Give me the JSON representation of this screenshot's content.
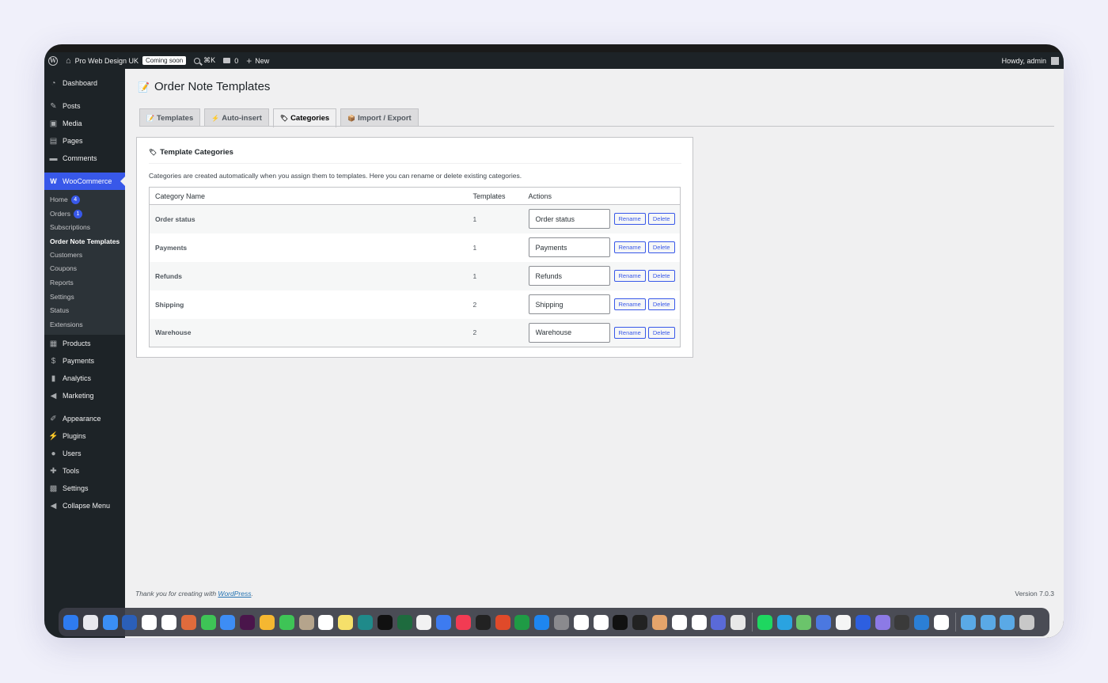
{
  "adminbar": {
    "site_name": "Pro Web Design UK",
    "coming_soon": "Coming soon",
    "shortcut": "⌘K",
    "comments_count": "0",
    "new_label": "New",
    "howdy": "Howdy, admin"
  },
  "sidebar": {
    "dashboard": "Dashboard",
    "posts": "Posts",
    "media": "Media",
    "pages": "Pages",
    "comments": "Comments",
    "woocommerce": "WooCommerce",
    "sub": {
      "home": "Home",
      "home_count": "4",
      "orders": "Orders",
      "orders_count": "1",
      "subscriptions": "Subscriptions",
      "order_note_templates": "Order Note Templates",
      "customers": "Customers",
      "coupons": "Coupons",
      "reports": "Reports",
      "settings": "Settings",
      "status": "Status",
      "extensions": "Extensions"
    },
    "products": "Products",
    "payments": "Payments",
    "analytics": "Analytics",
    "marketing": "Marketing",
    "appearance": "Appearance",
    "plugins": "Plugins",
    "users": "Users",
    "tools": "Tools",
    "settings": "Settings",
    "collapse": "Collapse Menu"
  },
  "page": {
    "title": "Order Note Templates",
    "tabs": {
      "templates": "Templates",
      "auto_insert": "Auto-insert",
      "categories": "Categories",
      "import_export": "Import / Export"
    },
    "card_title": "Template Categories",
    "description": "Categories are created automatically when you assign them to templates. Here you can rename or delete existing categories.",
    "table": {
      "headers": {
        "name": "Category Name",
        "templates": "Templates",
        "actions": "Actions"
      },
      "rename_label": "Rename",
      "delete_label": "Delete",
      "rows": [
        {
          "name": "Order status",
          "count": "1"
        },
        {
          "name": "Payments",
          "count": "1"
        },
        {
          "name": "Refunds",
          "count": "1"
        },
        {
          "name": "Shipping",
          "count": "2"
        },
        {
          "name": "Warehouse",
          "count": "2"
        }
      ]
    }
  },
  "footer": {
    "thanks_prefix": "Thank you for creating with ",
    "wordpress": "WordPress",
    "thanks_suffix": ".",
    "version": "Version 7.0.3"
  },
  "dock": {
    "icon_names": [
      "finder-icon",
      "launchpad-icon",
      "safari-icon",
      "maps-icon",
      "calendar-icon",
      "chatgpt-icon",
      "claude-icon",
      "messages-icon",
      "mail-icon",
      "slack-icon",
      "photos-icon",
      "facetime-icon",
      "contacts-icon",
      "reminders-icon",
      "notes-icon",
      "freeform-icon",
      "tv-icon",
      "app-icon",
      "app-icon",
      "app-icon",
      "music-icon",
      "terminal-icon",
      "app-icon",
      "numbers-icon",
      "app-store-icon",
      "settings-icon",
      "app-icon",
      "app-icon",
      "app-icon",
      "app-icon",
      "app-icon",
      "app-icon",
      "app-icon",
      "app-icon",
      "app-icon",
      "spotify-icon",
      "telegram-icon",
      "app-icon",
      "app-icon",
      "app-icon",
      "onepassword-icon",
      "app-icon",
      "app-icon",
      "vscode-icon",
      "chrome-icon",
      "folder-icon",
      "folder-icon",
      "folder-icon",
      "trash-icon"
    ],
    "icon_colors": [
      "#2e7bf0",
      "#e8e8ee",
      "#3a8ef5",
      "#2b5fb8",
      "#ffffff",
      "#ffffff",
      "#e06b3c",
      "#3ec456",
      "#3d8df5",
      "#4a154b",
      "#f5b731",
      "#3ec456",
      "#b5a48c",
      "#ffffff",
      "#f5e06a",
      "#1f8a8a",
      "#111111",
      "#1e6b3e",
      "#f2f2f2",
      "#3d7bf0",
      "#f23b53",
      "#222222",
      "#e04a2a",
      "#1f9b45",
      "#1e86f0",
      "#8a8a8e",
      "#ffffff",
      "#ffffff",
      "#111111",
      "#222222",
      "#e5a46b",
      "#ffffff",
      "#ffffff",
      "#5a6ad8",
      "#e8e8e8",
      "#1ed760",
      "#2aa3e0",
      "#6bc46b",
      "#4b78e0",
      "#f5f5f5",
      "#2d5fe0",
      "#8c7ae6",
      "#3a3a3a",
      "#2b7fd6",
      "#ffffff",
      "#5aa9e6",
      "#5aa9e6",
      "#5aa9e6",
      "#c8c8c8"
    ]
  }
}
